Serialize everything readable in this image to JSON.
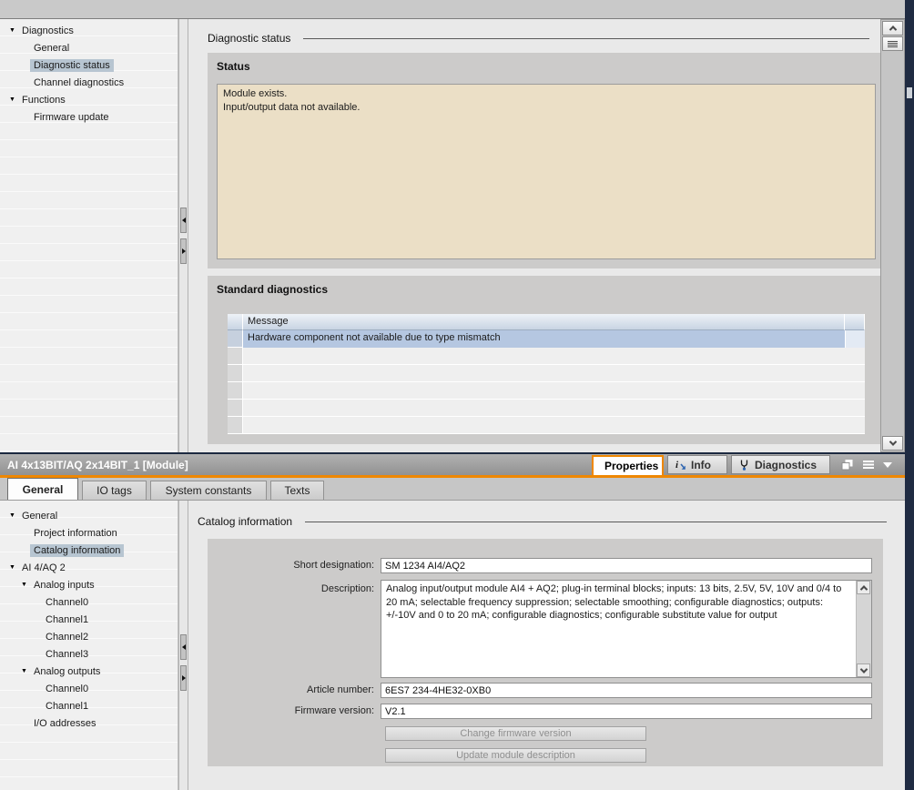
{
  "colors": {
    "accent_orange": "#ef8700",
    "row_selection_blue": "#b5c7e1",
    "tree_selection": "#b7c5d1",
    "status_beige": "#ebdfc6",
    "panel_gray": "#cccbca",
    "edge_navy": "#1f2b42"
  },
  "top_pane": {
    "title": "Diagnostic status",
    "tree": {
      "items": [
        {
          "label": "Diagnostics",
          "level": 0,
          "expanded": true
        },
        {
          "label": "General",
          "level": 1
        },
        {
          "label": "Diagnostic status",
          "level": 1,
          "selected": true
        },
        {
          "label": "Channel diagnostics",
          "level": 1
        },
        {
          "label": "Functions",
          "level": 0,
          "expanded": true
        },
        {
          "label": "Firmware update",
          "level": 1
        }
      ]
    },
    "status": {
      "heading": "Status",
      "line1": "Module exists.",
      "line2": "Input/output data not available."
    },
    "standard_diagnostics": {
      "heading": "Standard diagnostics",
      "column_header": "Message",
      "rows": [
        {
          "message": "Hardware component not available due to type mismatch",
          "selected": true
        }
      ],
      "empty_row_count": 5
    },
    "scrollbar_icons": [
      "chevron-up-icon",
      "list-icon",
      "chevron-down-icon"
    ]
  },
  "properties": {
    "title": "AI 4x13BIT/AQ 2x14BIT_1 [Module]",
    "view_tabs": [
      {
        "label": "Properties",
        "icon": "magnifier-icon",
        "selected": true
      },
      {
        "label": "Info",
        "icon": "info-arrow-icon",
        "selected": false
      },
      {
        "label": "Diagnostics",
        "icon": "stethoscope-icon",
        "selected": false
      }
    ],
    "window_icons": [
      "float-window-icon",
      "list-icon",
      "collapse-caret-icon"
    ],
    "tabs": [
      {
        "label": "General",
        "selected": true
      },
      {
        "label": "IO tags",
        "selected": false
      },
      {
        "label": "System constants",
        "selected": false
      },
      {
        "label": "Texts",
        "selected": false
      }
    ],
    "tree": {
      "items": [
        {
          "label": "General",
          "level": 0,
          "expanded": true
        },
        {
          "label": "Project information",
          "level": 1
        },
        {
          "label": "Catalog information",
          "level": 1,
          "selected": true
        },
        {
          "label": "AI 4/AQ 2",
          "level": 0,
          "expanded": true
        },
        {
          "label": "Analog inputs",
          "level": 1,
          "expanded": true
        },
        {
          "label": "Channel0",
          "level": 2
        },
        {
          "label": "Channel1",
          "level": 2
        },
        {
          "label": "Channel2",
          "level": 2
        },
        {
          "label": "Channel3",
          "level": 2
        },
        {
          "label": "Analog outputs",
          "level": 1,
          "expanded": true
        },
        {
          "label": "Channel0",
          "level": 2
        },
        {
          "label": "Channel1",
          "level": 2
        },
        {
          "label": "I/O addresses",
          "level": 1
        }
      ]
    },
    "catalog": {
      "title": "Catalog information",
      "short_designation_label": "Short designation:",
      "short_designation_value": "SM 1234 AI4/AQ2",
      "description_label": "Description:",
      "description_value": "Analog input/output module AI4 + AQ2; plug-in terminal blocks; inputs: 13 bits, 2.5V, 5V, 10V and 0/4 to 20 mA; selectable frequency suppression; selectable smoothing; configurable diagnostics; outputs: +/-10V and 0 to 20 mA; configurable diagnostics; configurable substitute value for output",
      "article_number_label": "Article number:",
      "article_number_value": "6ES7 234-4HE32-0XB0",
      "firmware_version_label": "Firmware version:",
      "firmware_version_value": "V2.1",
      "change_firmware_button": "Change firmware version",
      "update_description_button": "Update module description"
    }
  }
}
